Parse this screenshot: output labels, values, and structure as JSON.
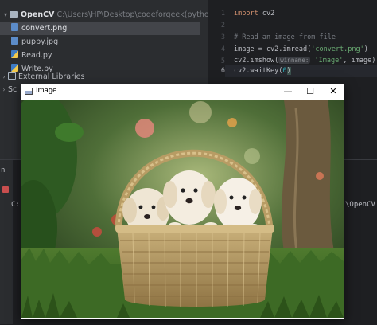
{
  "project": {
    "root_name": "OpenCV",
    "root_path": "C:\\Users\\HP\\Desktop\\codeforgeek(python)\\OpenCV",
    "files": [
      {
        "name": "convert.png",
        "icon": "image-file-icon"
      },
      {
        "name": "puppy.jpg",
        "icon": "image-file-icon"
      },
      {
        "name": "Read.py",
        "icon": "python-file-icon"
      },
      {
        "name": "Write.py",
        "icon": "python-file-icon"
      }
    ],
    "external_libraries": "External Libraries",
    "scratches_partial": "Sc"
  },
  "editor": {
    "line_numbers": [
      "1",
      "2",
      "3",
      "4",
      "5",
      "6"
    ],
    "active_line": "6",
    "lines": {
      "l1_kw": "import",
      "l1_rest": " cv2",
      "l3": "# Read an image from file",
      "l4_a": "image = cv2.imread(",
      "l4_str": "'convert.png'",
      "l4_b": ")",
      "l5_a": "cv2.imshow(",
      "l5_hint": "winname:",
      "l5_str": "'Image'",
      "l5_b": ", image)",
      "l6_a": "cv2.waitKey(",
      "l6_num": "0",
      "l6_b": ")"
    }
  },
  "bottom_panel": {
    "tab_partial": "n",
    "console_left": "C:",
    "console_right": "\\OpenCV"
  },
  "image_window": {
    "title": "Image",
    "minimize_glyph": "—",
    "maximize_glyph": "☐",
    "close_glyph": "✕"
  },
  "colors": {
    "ide_bg": "#2b2d30",
    "editor_bg": "#1e1f22",
    "keyword": "#cf8e6d",
    "string": "#6aab73",
    "number": "#2aacb8",
    "comment": "#7a7e85"
  }
}
